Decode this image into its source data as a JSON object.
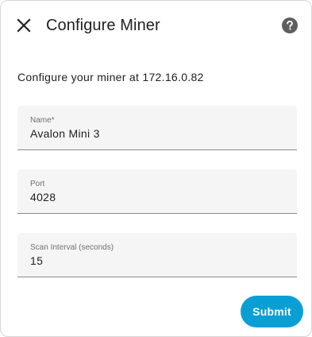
{
  "dialog": {
    "title": "Configure Miner",
    "description": "Configure your miner at 172.16.0.82",
    "close_icon": "close-icon",
    "help_icon": "help-circle-icon"
  },
  "fields": {
    "name": {
      "label": "Name*",
      "value": "Avalon Mini 3"
    },
    "port": {
      "label": "Port",
      "value": "4028"
    },
    "scan_interval": {
      "label": "Scan Interval (seconds)",
      "value": "15"
    }
  },
  "actions": {
    "submit_label": "Submit"
  },
  "colors": {
    "accent": "#0a9fd4",
    "field_bg": "#f5f5f5",
    "text": "#212121",
    "label": "#707070",
    "icon": "#5f5f5f"
  }
}
